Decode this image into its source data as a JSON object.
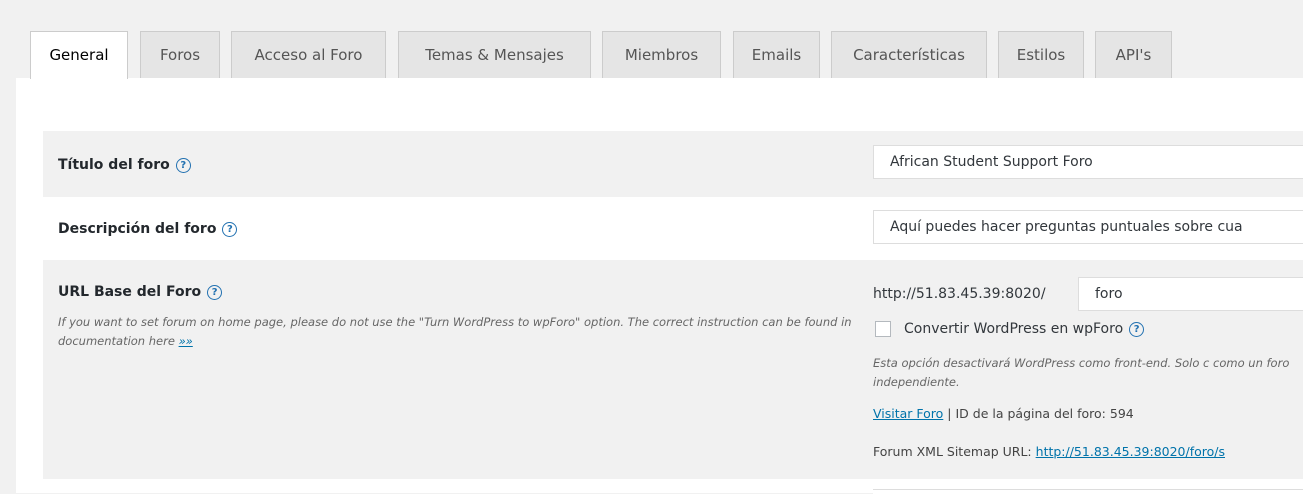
{
  "tabs": [
    {
      "label": "General",
      "active": true
    },
    {
      "label": "Foros"
    },
    {
      "label": "Acceso al Foro"
    },
    {
      "label": "Temas & Mensajes"
    },
    {
      "label": "Miembros"
    },
    {
      "label": "Emails"
    },
    {
      "label": "Características"
    },
    {
      "label": "Estilos"
    },
    {
      "label": "API's"
    }
  ],
  "settings": {
    "forum_title": {
      "label": "Título del foro",
      "value": "African Student Support Foro"
    },
    "forum_description": {
      "label": "Descripción del foro",
      "value": "Aquí puedes hacer preguntas puntuales sobre cua"
    },
    "base_url": {
      "label": "URL Base del Foro",
      "note": "If you want to set forum on home page, please do not use the \"Turn WordPress to wpForo\" option. The correct instruction can be found in documentation here",
      "note_link": "»»",
      "prefix": "http://51.83.45.39:8020/",
      "slug": "foro",
      "checkbox_label": "Convertir WordPress en wpForo",
      "checkbox_checked": false,
      "checkbox_note": "Esta opción desactivará WordPress como front-end. Solo c como un foro independiente.",
      "visit_link": "Visitar Foro",
      "separator": "|",
      "page_id_text": "ID de la página del foro: 594",
      "sitemap_label": "Forum XML Sitemap URL:",
      "sitemap_url": "http://51.83.45.39:8020/foro/s"
    }
  },
  "icons": {
    "help": "question-circle-icon"
  },
  "colors": {
    "link": "#0073aa",
    "row_shade": "#f1f1f1",
    "tab_inactive": "#e5e5e5"
  }
}
